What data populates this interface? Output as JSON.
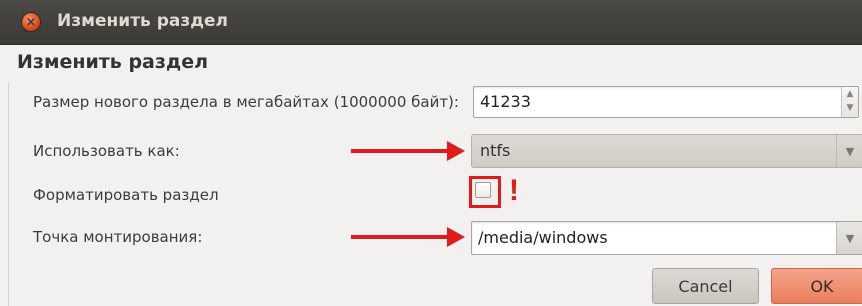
{
  "window": {
    "title": "Изменить раздел",
    "close_icon": "close-icon",
    "close_glyph": "×"
  },
  "dialog": {
    "heading": "Изменить раздел"
  },
  "size": {
    "label": "Размер нового раздела в мегабайтах (1000000 байт):",
    "value": "41233",
    "up_glyph": "▲",
    "down_glyph": "▼"
  },
  "use_as": {
    "label": "Использовать как:",
    "value": "ntfs",
    "drop_glyph": "▼"
  },
  "format": {
    "label": "Форматировать раздел",
    "checked": false,
    "annotation": "!"
  },
  "mount": {
    "label": "Точка монтирования:",
    "value": "/media/windows",
    "drop_glyph": "▼"
  },
  "buttons": {
    "cancel": "Cancel",
    "ok": "OK"
  },
  "colors": {
    "annotation": "#e01b1b",
    "titlebar": "#3b3a36",
    "ok_button": "#ea7f5e"
  }
}
